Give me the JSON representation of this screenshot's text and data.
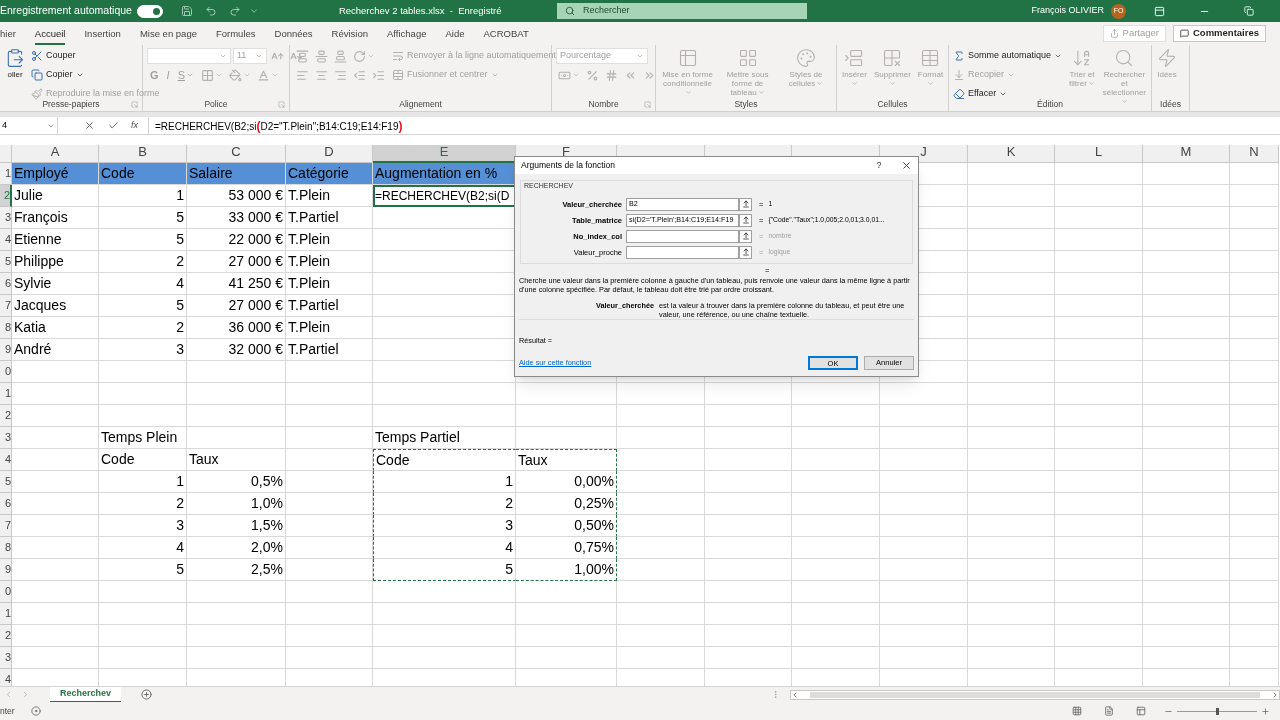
{
  "title_bar": {
    "autosave_label": "Enregistrement automatique",
    "autosave_on": true,
    "document": "Recherchev 2 tables.xlsx  -  Enregistré",
    "search_placeholder": "Rechercher",
    "user": "François OLIVIER",
    "avatar": "FO"
  },
  "tabs": [
    {
      "label": "hier",
      "selected": false
    },
    {
      "label": "Accueil",
      "selected": true
    },
    {
      "label": "Insertion",
      "selected": false
    },
    {
      "label": "Mise en page",
      "selected": false
    },
    {
      "label": "Formules",
      "selected": false
    },
    {
      "label": "Données",
      "selected": false
    },
    {
      "label": "Révision",
      "selected": false
    },
    {
      "label": "Affichage",
      "selected": false
    },
    {
      "label": "Aide",
      "selected": false
    },
    {
      "label": "ACROBAT",
      "selected": false
    }
  ],
  "share": {
    "label": "Partager",
    "disabled": true
  },
  "comments": {
    "label": "Commentaires"
  },
  "ribbon": [
    {
      "title": "Presse-papiers",
      "launcher": true,
      "columns": [
        [
          [
            {
              "kind": "large",
              "label": "oller",
              "disabled": false
            }
          ]
        ],
        [
          [
            {
              "kind": "small",
              "label": "Couper",
              "disabled": false
            }
          ],
          [
            {
              "kind": "small-menu",
              "label": "Copier",
              "disabled": false
            }
          ],
          [
            {
              "kind": "small",
              "label": "Reproduire la mise en forme",
              "disabled": true
            }
          ]
        ]
      ]
    },
    {
      "title": "Police",
      "launcher": true,
      "columns": [
        [
          [
            {
              "kind": "field",
              "disabled": true
            },
            {
              "kind": "field",
              "label": "11",
              "disabled": true
            },
            {
              "kind": "icon",
              "disabled": true
            },
            {
              "kind": "icon",
              "disabled": true
            }
          ],
          [
            {
              "kind": "letter",
              "label": "G",
              "disabled": true
            },
            {
              "kind": "letter",
              "label": "I",
              "disabled": true
            },
            {
              "kind": "letter-menu",
              "label": "S",
              "disabled": true
            },
            {
              "kind": "icon-menu",
              "disabled": true
            },
            {
              "kind": "icon-menu",
              "disabled": true
            },
            {
              "kind": "icon-menu",
              "disabled": true
            }
          ]
        ]
      ]
    },
    {
      "title": "Alignement",
      "launcher": false,
      "columns": [
        [
          [
            {
              "kind": "icon",
              "disabled": true
            },
            {
              "kind": "icon",
              "disabled": true
            },
            {
              "kind": "icon",
              "disabled": true
            },
            {
              "kind": "icon-menu",
              "disabled": true
            }
          ],
          [
            {
              "kind": "icon",
              "disabled": true
            },
            {
              "kind": "icon",
              "disabled": true
            },
            {
              "kind": "icon",
              "disabled": true
            },
            {
              "kind": "icon",
              "disabled": true
            },
            {
              "kind": "icon",
              "disabled": true
            }
          ]
        ],
        [
          [
            {
              "kind": "small",
              "label": "Renvoyer à la ligne automatiquement",
              "disabled": true
            }
          ],
          [
            {
              "kind": "small-menu",
              "label": "Fusionner et centrer",
              "disabled": true
            }
          ]
        ]
      ]
    },
    {
      "title": "Nombre",
      "launcher": true,
      "columns": [
        [
          [
            {
              "kind": "field",
              "label": "Pourcentage",
              "disabled": true
            }
          ],
          [
            {
              "kind": "icon-menu",
              "disabled": true
            },
            {
              "kind": "icon",
              "disabled": true
            },
            {
              "kind": "icon",
              "disabled": true
            },
            {
              "kind": "icon",
              "disabled": true
            },
            {
              "kind": "icon",
              "disabled": true
            }
          ]
        ]
      ]
    },
    {
      "title": "Styles",
      "launcher": false,
      "columns": [
        [
          [
            {
              "kind": "large-menu",
              "label": "Mise en forme conditionnelle",
              "disabled": true
            }
          ]
        ],
        [
          [
            {
              "kind": "large-menu",
              "label": "Mettre sous forme de tableau",
              "disabled": true
            }
          ]
        ],
        [
          [
            {
              "kind": "large-menu",
              "label": "Styles de cellules",
              "disabled": true
            }
          ]
        ]
      ]
    },
    {
      "title": "Cellules",
      "launcher": false,
      "columns": [
        [
          [
            {
              "kind": "large-menu",
              "label": "Insérer",
              "disabled": true
            }
          ]
        ],
        [
          [
            {
              "kind": "large-menu",
              "label": "Supprimer",
              "disabled": true
            }
          ]
        ],
        [
          [
            {
              "kind": "large-menu",
              "label": "Format",
              "disabled": true
            }
          ]
        ]
      ]
    },
    {
      "title": "Édition",
      "launcher": false,
      "columns": [
        [
          [
            {
              "kind": "small-menu",
              "label": "Somme automatique",
              "disabled": false
            }
          ],
          [
            {
              "kind": "small-menu",
              "label": "Recopier",
              "disabled": true
            }
          ],
          [
            {
              "kind": "small-menu",
              "label": "Effacer",
              "disabled": false
            }
          ]
        ],
        [
          [
            {
              "kind": "large-menu",
              "label": "Trier et filtrer",
              "disabled": true
            }
          ]
        ],
        [
          [
            {
              "kind": "large-menu",
              "label": "Rechercher et sélectionner",
              "disabled": true
            }
          ]
        ]
      ]
    },
    {
      "title": "Idées",
      "launcher": false,
      "columns": [
        [
          [
            {
              "kind": "large",
              "label": "Idées",
              "disabled": true
            }
          ]
        ]
      ]
    }
  ],
  "formula_bar": {
    "name_box": "4",
    "function_label": "fx",
    "formula": [
      {
        "text": "=RECHERCHEV(B2;si"
      },
      {
        "text": "(",
        "color": "#e81123"
      },
      {
        "text": "D2=\"T.Plein\";B14:C19;E14:F19"
      },
      {
        "text": ")",
        "color": "#e81123"
      }
    ]
  },
  "columns": [
    {
      "label": "A"
    },
    {
      "label": "B"
    },
    {
      "label": "C"
    },
    {
      "label": "D"
    },
    {
      "label": "E"
    },
    {
      "label": "F"
    },
    {},
    {},
    {},
    {
      "label": "J"
    },
    {
      "label": "K"
    },
    {
      "label": "L"
    },
    {
      "label": "M"
    },
    {
      "label": "N"
    }
  ],
  "rows": [
    {
      "label": "1",
      "header": true,
      "cells": [
        {
          "text": "Employé",
          "kind": "text",
          "selected": false
        },
        {
          "text": "Code",
          "kind": "text",
          "selected": false
        },
        {
          "text": "Salaire",
          "kind": "text",
          "selected": false
        },
        {
          "text": "Catégorie",
          "kind": "text",
          "selected": false
        },
        {
          "text": "Augmentation en %",
          "kind": "text",
          "selected": false
        }
      ]
    },
    {
      "label": "2",
      "cells": [
        {
          "text": "Julie",
          "kind": "text",
          "selected": false
        },
        {
          "text": "1",
          "kind": "number",
          "selected": false
        },
        {
          "text": "53 000 €",
          "kind": "number",
          "selected": false
        },
        {
          "text": "T.Plein",
          "kind": "text",
          "selected": false
        },
        {
          "text": "=RECHERCHEV(B2;si(D",
          "kind": "text",
          "selected": true
        }
      ]
    },
    {
      "label": "3",
      "cells": [
        {
          "text": "François",
          "kind": "text",
          "selected": false
        },
        {
          "text": "5",
          "kind": "number",
          "selected": false
        },
        {
          "text": "33 000 €",
          "kind": "number",
          "selected": false
        },
        {
          "text": "T.Partiel",
          "kind": "text",
          "selected": false
        }
      ]
    },
    {
      "label": "4",
      "cells": [
        {
          "text": "Etienne",
          "kind": "text",
          "selected": false
        },
        {
          "text": "5",
          "kind": "number",
          "selected": false
        },
        {
          "text": "22 000 €",
          "kind": "number",
          "selected": false
        },
        {
          "text": "T.Plein",
          "kind": "text",
          "selected": false
        }
      ]
    },
    {
      "label": "5",
      "cells": [
        {
          "text": "Philippe",
          "kind": "text",
          "selected": false
        },
        {
          "text": "2",
          "kind": "number",
          "selected": false
        },
        {
          "text": "27 000 €",
          "kind": "number",
          "selected": false
        },
        {
          "text": "T.Plein",
          "kind": "text",
          "selected": false
        }
      ]
    },
    {
      "label": "6",
      "cells": [
        {
          "text": "Sylvie",
          "kind": "text",
          "selected": false
        },
        {
          "text": "4",
          "kind": "number",
          "selected": false
        },
        {
          "text": "41 250 €",
          "kind": "number",
          "selected": false
        },
        {
          "text": "T.Plein",
          "kind": "text",
          "selected": false
        }
      ]
    },
    {
      "label": "7",
      "cells": [
        {
          "text": "Jacques",
          "kind": "text",
          "selected": false
        },
        {
          "text": "5",
          "kind": "number",
          "selected": false
        },
        {
          "text": "27 000 €",
          "kind": "number",
          "selected": false
        },
        {
          "text": "T.Partiel",
          "kind": "text",
          "selected": false
        }
      ]
    },
    {
      "label": "8",
      "cells": [
        {
          "text": "Katia",
          "kind": "text",
          "selected": false
        },
        {
          "text": "2",
          "kind": "number",
          "selected": false
        },
        {
          "text": "36 000 €",
          "kind": "number",
          "selected": false
        },
        {
          "text": "T.Plein",
          "kind": "text",
          "selected": false
        }
      ]
    },
    {
      "label": "9",
      "cells": [
        {
          "text": "André",
          "kind": "text",
          "selected": false
        },
        {
          "text": "3",
          "kind": "number",
          "selected": false
        },
        {
          "text": "32 000 €",
          "kind": "number",
          "selected": false
        },
        {
          "text": "T.Partiel",
          "kind": "text",
          "selected": false
        }
      ]
    },
    {
      "label": "0"
    },
    {
      "label": "1"
    },
    {
      "label": "2"
    },
    {
      "label": "3",
      "cells": [
        null,
        {
          "text": "Temps Plein",
          "kind": "text",
          "selected": false
        },
        null,
        null,
        {
          "text": "Temps Partiel",
          "kind": "text",
          "selected": false
        }
      ]
    },
    {
      "label": "4",
      "cells": [
        null,
        {
          "text": "Code",
          "kind": "text",
          "selected": false
        },
        {
          "text": "Taux",
          "kind": "text",
          "selected": false
        },
        null,
        {
          "text": "Code",
          "kind": "text",
          "selected": false,
          "marquee": true
        },
        {
          "text": "Taux",
          "kind": "text",
          "selected": false,
          "marquee": true
        }
      ]
    },
    {
      "label": "5",
      "cells": [
        null,
        {
          "text": "1",
          "kind": "number",
          "selected": false
        },
        {
          "text": "0,5%",
          "kind": "number",
          "selected": false
        },
        null,
        {
          "text": "1",
          "kind": "number",
          "selected": false,
          "marquee": true
        },
        {
          "text": "0,00%",
          "kind": "number",
          "selected": false,
          "marquee": true
        }
      ]
    },
    {
      "label": "6",
      "cells": [
        null,
        {
          "text": "2",
          "kind": "number",
          "selected": false
        },
        {
          "text": "1,0%",
          "kind": "number",
          "selected": false
        },
        null,
        {
          "text": "2",
          "kind": "number",
          "selected": false,
          "marquee": true
        },
        {
          "text": "0,25%",
          "kind": "number",
          "selected": false,
          "marquee": true
        }
      ]
    },
    {
      "label": "7",
      "cells": [
        null,
        {
          "text": "3",
          "kind": "number",
          "selected": false
        },
        {
          "text": "1,5%",
          "kind": "number",
          "selected": false
        },
        null,
        {
          "text": "3",
          "kind": "number",
          "selected": false,
          "marquee": true
        },
        {
          "text": "0,50%",
          "kind": "number",
          "selected": false,
          "marquee": true
        }
      ]
    },
    {
      "label": "8",
      "cells": [
        null,
        {
          "text": "4",
          "kind": "number",
          "selected": false
        },
        {
          "text": "2,0%",
          "kind": "number",
          "selected": false
        },
        null,
        {
          "text": "4",
          "kind": "number",
          "selected": false,
          "marquee": true
        },
        {
          "text": "0,75%",
          "kind": "number",
          "selected": false,
          "marquee": true
        }
      ]
    },
    {
      "label": "9",
      "cells": [
        null,
        {
          "text": "5",
          "kind": "number",
          "selected": false
        },
        {
          "text": "2,5%",
          "kind": "number",
          "selected": false
        },
        null,
        {
          "text": "5",
          "kind": "number",
          "selected": false,
          "marquee": true
        },
        {
          "text": "1,00%",
          "kind": "number",
          "selected": false,
          "marquee": true
        }
      ]
    },
    {
      "label": "0"
    },
    {
      "label": "1"
    },
    {
      "label": "2"
    },
    {
      "label": "3"
    },
    {
      "label": "4"
    }
  ],
  "dialog": {
    "title": "Arguments de la fonction",
    "help": "?",
    "function": "RECHERCHEV",
    "arguments": [
      {
        "name": "Valeur_cherchée",
        "required": true,
        "value": "B2",
        "equals": "=",
        "result": "1",
        "greyed": false
      },
      {
        "name": "Table_matrice",
        "required": true,
        "value": "si(D2='T.Plein';B14:C19;E14:F19",
        "equals": "=",
        "result": "{\"Code\".\"Taux\";1.0,005;2.0,01;3.0,01...",
        "greyed": false
      },
      {
        "name": "No_index_col",
        "required": true,
        "equals": "=",
        "result": "nombre",
        "greyed": true
      },
      {
        "name": "Valeur_proche",
        "required": false,
        "equals": "=",
        "result": "logique",
        "greyed": true
      }
    ],
    "total": "=",
    "description": "Cherche une valeur dans la première colonne à gauche d'un tableau, puis renvoie une valeur dans la même ligne à partir d'une colonne spécifiée. Par défaut, le tableau doit être trié par ordre croissant.",
    "argument_help": {
      "name": "Valeur_cherchée",
      "text": "est la valeur à trouver dans la première colonne du tableau, et peut être une valeur, une référence, ou une chaîne textuelle."
    },
    "result_label": "Résultat =",
    "help_link": "Aide sur cette fonction",
    "buttons": [
      {
        "label": "OK",
        "default": true
      },
      {
        "label": "Annuler",
        "default": false
      }
    ]
  },
  "sheet_tabs": [
    {
      "label": "Recherchev",
      "selected": true
    }
  ],
  "status_bar": {
    "mode": "nter",
    "zoom": {
      "level": 0.5
    }
  }
}
